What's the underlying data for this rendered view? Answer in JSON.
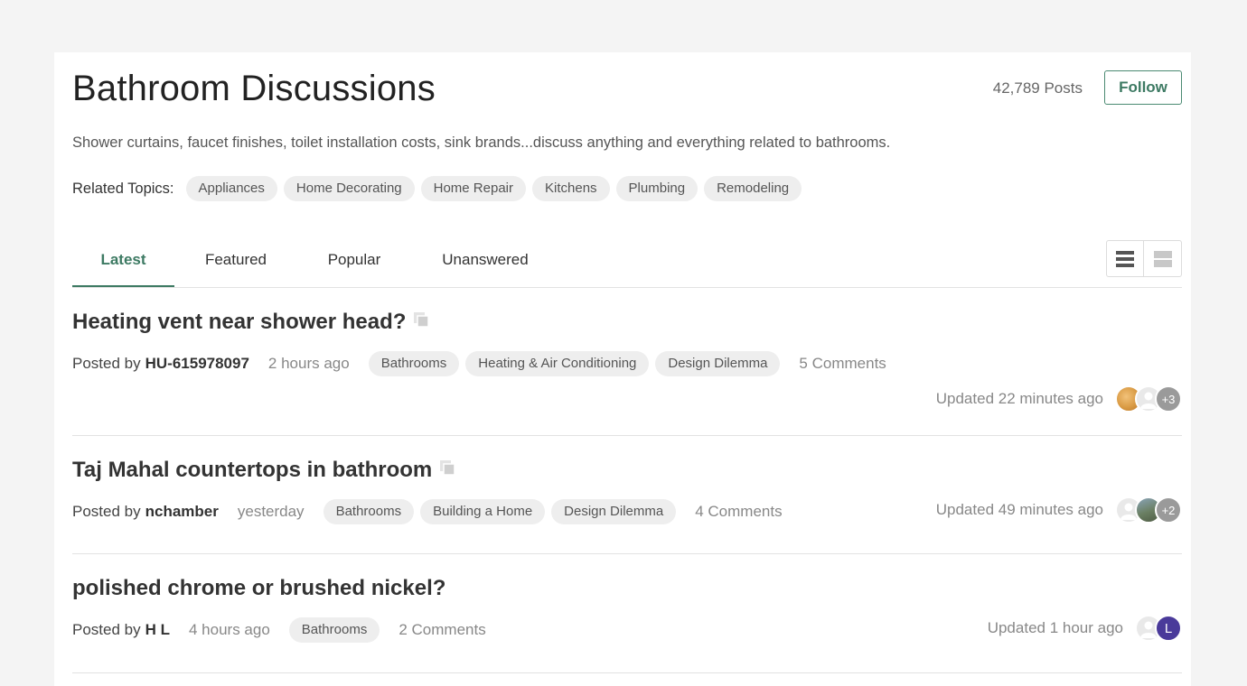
{
  "header": {
    "title": "Bathroom Discussions",
    "post_count": "42,789 Posts",
    "follow_label": "Follow",
    "description": "Shower curtains, faucet finishes, toilet installation costs, sink brands...discuss anything and everything related to bathrooms."
  },
  "related": {
    "label": "Related Topics:",
    "topics": [
      "Appliances",
      "Home Decorating",
      "Home Repair",
      "Kitchens",
      "Plumbing",
      "Remodeling"
    ]
  },
  "tabs": [
    {
      "label": "Latest",
      "active": true
    },
    {
      "label": "Featured"
    },
    {
      "label": "Popular"
    },
    {
      "label": "Unanswered"
    }
  ],
  "view_toggle": {
    "options": [
      {
        "icon": "list-view-icon",
        "active": true
      },
      {
        "icon": "compact-view-icon",
        "active": false
      }
    ]
  },
  "posts": [
    {
      "title": "Heating vent near shower head?",
      "has_photo_icon": true,
      "posted_by_label": "Posted by",
      "author": "HU-615978097",
      "time": "2 hours ago",
      "tags": [
        "Bathrooms",
        "Heating & Air Conditioning",
        "Design Dilemma"
      ],
      "comments": "5 Comments",
      "updated": "Updated 22 minutes ago",
      "avatars": [
        {
          "type": "photo-food"
        },
        {
          "type": "default-user"
        },
        {
          "type": "more",
          "text": "+3"
        }
      ]
    },
    {
      "title": "Taj Mahal countertops in bathroom",
      "has_photo_icon": true,
      "posted_by_label": "Posted by",
      "author": "nchamber",
      "time": "yesterday",
      "tags": [
        "Bathrooms",
        "Building a Home",
        "Design Dilemma"
      ],
      "comments": "4 Comments",
      "updated": "Updated 49 minutes ago",
      "avatars": [
        {
          "type": "default-user"
        },
        {
          "type": "photo-landscape"
        },
        {
          "type": "more",
          "text": "+2"
        }
      ]
    },
    {
      "title": "polished chrome or brushed nickel?",
      "has_photo_icon": false,
      "posted_by_label": "Posted by",
      "author": "H L",
      "time": "4 hours ago",
      "tags": [
        "Bathrooms"
      ],
      "comments": "2 Comments",
      "updated": "Updated 1 hour ago",
      "avatars": [
        {
          "type": "default-user"
        },
        {
          "type": "letter",
          "text": "L"
        }
      ]
    }
  ],
  "colors": {
    "accent": "#3d7a63",
    "pill_bg": "#eeeeee",
    "page_bg": "#f4f4f4",
    "letter_avatar": "#4a3a9a"
  }
}
